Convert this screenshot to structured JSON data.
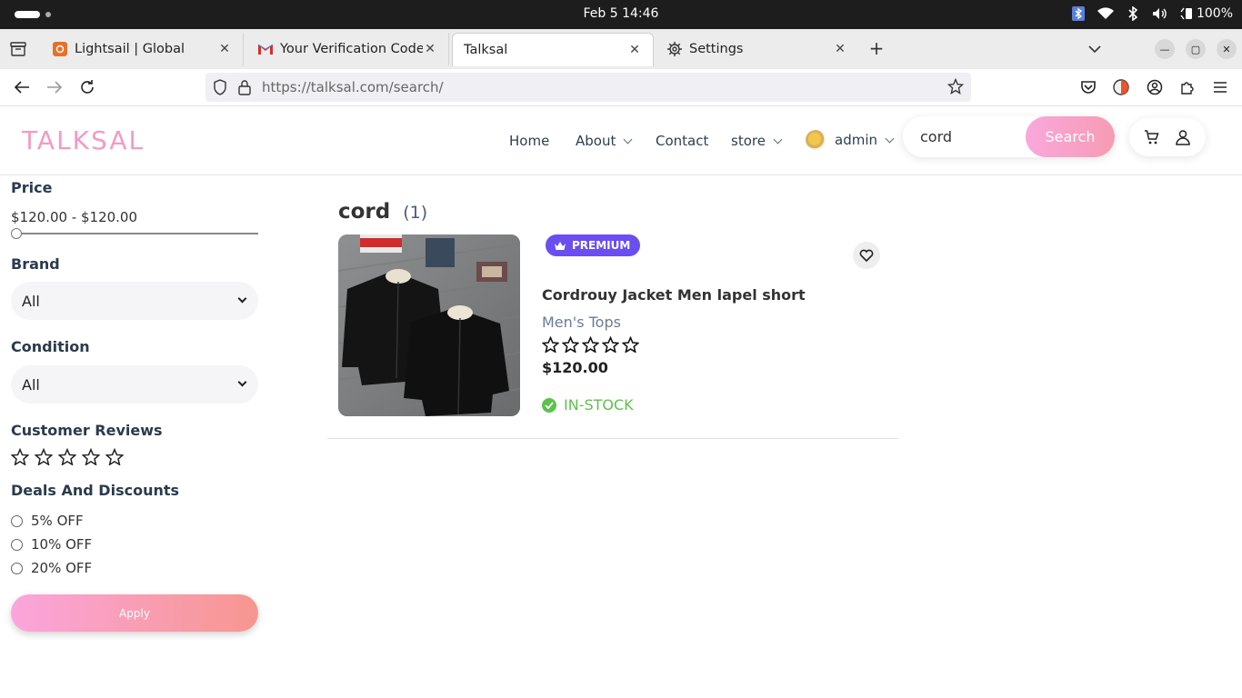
{
  "os": {
    "clock": "Feb 5  14:46",
    "battery": "100%"
  },
  "browser": {
    "tabs": [
      {
        "title": "Lightsail | Global",
        "icon": "lightsail-icon"
      },
      {
        "title": "Your Verification Code - |",
        "icon": "gmail-icon"
      },
      {
        "title": "Talksal",
        "icon": "",
        "active": true
      },
      {
        "title": "Settings",
        "icon": "gear-icon"
      }
    ],
    "url": "https://talksal.com/search/"
  },
  "site": {
    "logo": "TALKSAL",
    "menu": {
      "home": "Home",
      "about": "About",
      "contact": "Contact",
      "store": "store",
      "admin": "admin"
    },
    "search": {
      "value": "cord",
      "button": "Search"
    }
  },
  "filters": {
    "price_title": "Price",
    "price_range": "$120.00 - $120.00",
    "slider_fraction": 0,
    "brand_title": "Brand",
    "brand_value": "All",
    "condition_title": "Condition",
    "condition_value": "All",
    "reviews_title": "Customer Reviews",
    "reviews_rating": 0,
    "deals_title": "Deals And Discounts",
    "deals": [
      "5% OFF",
      "10% OFF",
      "20% OFF"
    ],
    "apply": "Apply"
  },
  "results": {
    "query": "cord",
    "count": "(1)",
    "products": [
      {
        "badge": "PREMIUM",
        "name": "Cordrouy Jacket Men lapel short",
        "category": "Men's Tops",
        "rating": 0,
        "price": "$120.00",
        "stock": "IN-STOCK"
      }
    ]
  },
  "colors": {
    "brand_pink": "#f59ac2",
    "badge_purple": "#6a4ef0",
    "stock_green": "#5cc24c",
    "nav_text": "#2d3e52"
  }
}
